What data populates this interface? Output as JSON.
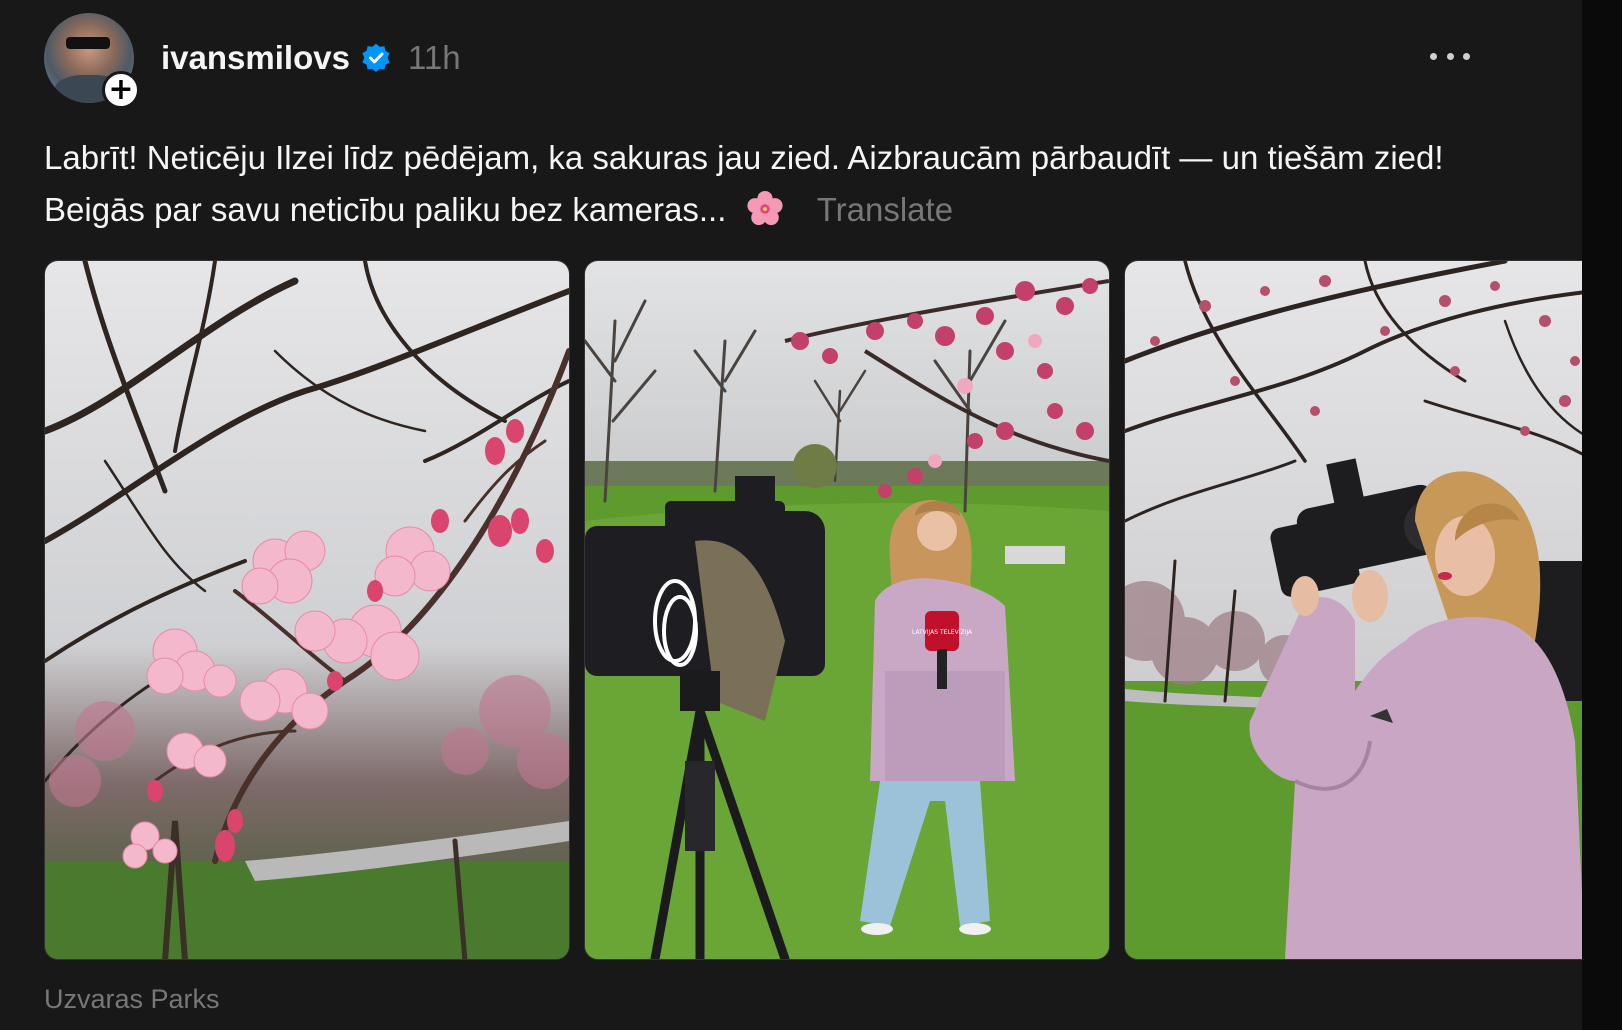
{
  "post": {
    "username": "ivansmilovs",
    "timestamp": "11h",
    "verified": true,
    "follow_badge": "+",
    "caption": "Labrīt! Neticēju Ilzei līdz pēdējam, ka sakuras jau zied. Aizbraucām pārbaudīt — un tiešām zied! Beigās par savu neticību paliku bez kameras...",
    "caption_emoji": "cherry-blossom-icon",
    "translate_label": "Translate",
    "location": "Uzvaras Parks",
    "photo_microphone_text": "LATVIJAS TELEVĪZIJA"
  },
  "colors": {
    "background": "#181818",
    "text_primary": "#f3f5f7",
    "text_secondary": "#777777",
    "verified_badge": "#0095f6"
  },
  "icons": {
    "more": "more-options-icon",
    "verified": "verified-badge-icon",
    "follow": "follow-plus-icon"
  }
}
